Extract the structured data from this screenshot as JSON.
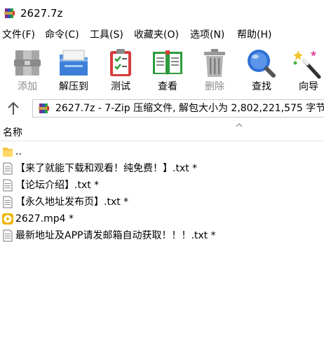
{
  "window": {
    "title": "2627.7z"
  },
  "menu": [
    "文件(F)",
    "命令(C)",
    "工具(S)",
    "收藏夹(O)",
    "选项(N)",
    "帮助(H)"
  ],
  "toolbar": {
    "add": "添加",
    "extract": "解压到",
    "test": "测试",
    "view": "查看",
    "delete": "删除",
    "find": "查找",
    "wizard": "向导"
  },
  "address": {
    "path": "2627.7z - 7-Zip 压缩文件, 解包大小为 2,802,221,575 字节"
  },
  "columns": {
    "name": "名称"
  },
  "files": [
    {
      "name": "..",
      "icon": "folder-up-icon"
    },
    {
      "name": "【来了就能下载和观看！纯免费！】.txt *",
      "icon": "text-file-icon"
    },
    {
      "name": "【论坛介绍】.txt *",
      "icon": "text-file-icon"
    },
    {
      "name": "【永久地址发布页】.txt *",
      "icon": "text-file-icon"
    },
    {
      "name": "2627.mp4 *",
      "icon": "video-file-icon"
    },
    {
      "name": "最新地址及APP请发邮箱自动获取！！！.txt *",
      "icon": "text-file-icon"
    }
  ],
  "colors": {
    "video_icon": "#f0b400",
    "folder": "#f5c242",
    "find_blue": "#2f6fd6"
  }
}
